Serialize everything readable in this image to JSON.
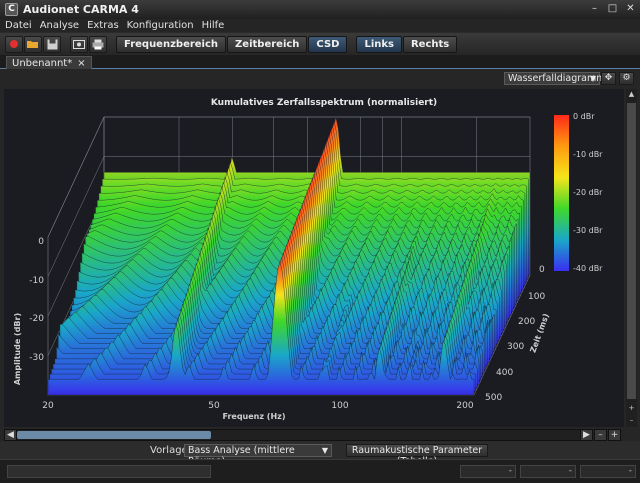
{
  "window": {
    "title": "Audionet CARMA 4",
    "app_icon_letter": "C"
  },
  "menu": [
    "Datei",
    "Analyse",
    "Extras",
    "Konfiguration",
    "Hilfe"
  ],
  "toolbar": {
    "icons": [
      "record-icon",
      "open-folder-icon",
      "save-icon",
      "screenshot-icon",
      "print-icon"
    ],
    "mode_buttons": [
      {
        "label": "Frequenzbereich",
        "active": false
      },
      {
        "label": "Zeitbereich",
        "active": false
      },
      {
        "label": "CSD",
        "active": true
      }
    ],
    "channel_buttons": [
      {
        "label": "Links",
        "active": true
      },
      {
        "label": "Rechts",
        "active": false
      }
    ]
  },
  "document_tab": {
    "label": "Unbenannt*",
    "close": "×"
  },
  "view_selector": {
    "value": "Wasserfalldiagramm"
  },
  "chart_data": {
    "type": "waterfall",
    "title": "Kumulatives Zerfallsspektrum (normalisiert)",
    "xlabel": "Frequenz (Hz)",
    "ylabel": "Amplitude (dBr)",
    "zlabel": "Zeit (ms)",
    "x_ticks": [
      "20",
      "50",
      "100",
      "200"
    ],
    "y_ticks": [
      "0",
      "-10",
      "-20",
      "-30"
    ],
    "z_ticks": [
      "0",
      "100",
      "200",
      "300",
      "400",
      "500"
    ],
    "colorbar": {
      "labels": [
        "0 dBr",
        "-10 dBr",
        "-20 dBr",
        "-30 dBr",
        "-40 dBr"
      ],
      "colors": [
        "#ff2a1a",
        "#ff9a10",
        "#f5e51a",
        "#3fd82a",
        "#1aa8c8",
        "#3a2ef0"
      ]
    },
    "ylim": [
      -40,
      0
    ],
    "xlim": [
      20,
      200
    ],
    "zlim": [
      0,
      500
    ],
    "peak_frequency_hz": 70,
    "peak_level_dbr": 0
  },
  "footer": {
    "templates_label": "Vorlagen",
    "templates_value": "Bass Analyse (mittlere Räume)",
    "room_params_button": "Raumakustische Parameter (Tabelle)"
  },
  "status": {
    "fields": [
      "-",
      "-",
      "-"
    ]
  }
}
